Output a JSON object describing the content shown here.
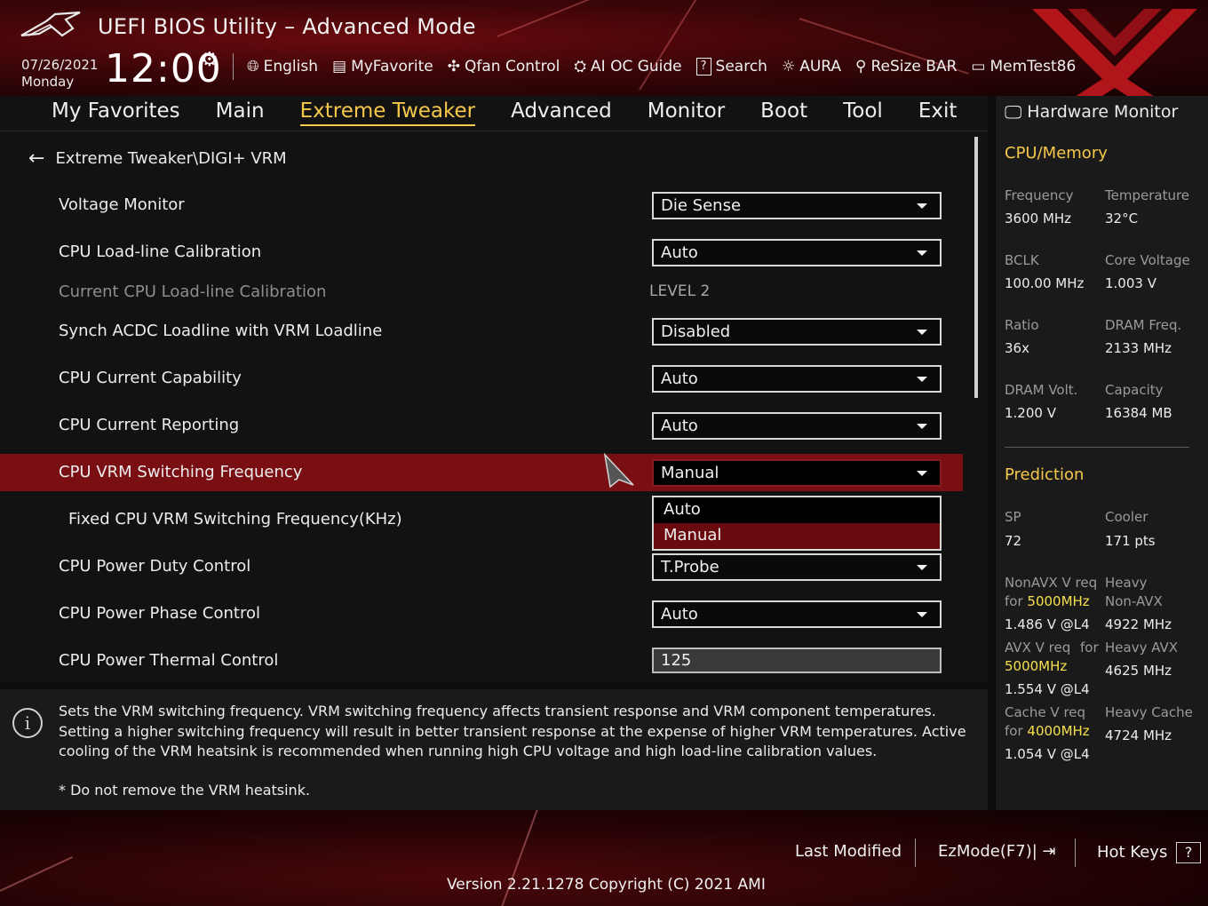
{
  "header": {
    "title": "UEFI BIOS Utility – Advanced Mode",
    "date": "07/26/2021",
    "day": "Monday",
    "time": "12:00",
    "tools": [
      {
        "icon": "globe-icon",
        "label": "English"
      },
      {
        "icon": "favorite-icon",
        "label": "MyFavorite"
      },
      {
        "icon": "fan-icon",
        "label": "Qfan Control"
      },
      {
        "icon": "ai-oc-icon",
        "label": "AI OC Guide"
      },
      {
        "icon": "search-icon",
        "label": "Search"
      },
      {
        "icon": "aura-icon",
        "label": "AURA"
      },
      {
        "icon": "resize-bar-icon",
        "label": "ReSize BAR"
      },
      {
        "icon": "memtest-icon",
        "label": "MemTest86"
      }
    ]
  },
  "nav": {
    "tabs": [
      "My Favorites",
      "Main",
      "Extreme Tweaker",
      "Advanced",
      "Monitor",
      "Boot",
      "Tool",
      "Exit"
    ],
    "active": "Extreme Tweaker"
  },
  "main": {
    "breadcrumb": "Extreme Tweaker\\DIGI+ VRM",
    "rows": [
      {
        "label": "Voltage Monitor",
        "value": "Die Sense"
      },
      {
        "label": "CPU Load-line Calibration",
        "value": "Auto"
      },
      {
        "label": "Current CPU Load-line Calibration",
        "value": "LEVEL 2"
      },
      {
        "label": "Synch ACDC Loadline with VRM Loadline",
        "value": "Disabled"
      },
      {
        "label": "CPU Current Capability",
        "value": "Auto"
      },
      {
        "label": "CPU Current Reporting",
        "value": "Auto"
      },
      {
        "label": "CPU VRM Switching Frequency",
        "value": "Manual"
      },
      {
        "label": "Fixed CPU VRM Switching Frequency(KHz)",
        "value": ""
      },
      {
        "label": "CPU Power Duty Control",
        "value": "T.Probe"
      },
      {
        "label": "CPU Power Phase Control",
        "value": "Auto"
      },
      {
        "label": "CPU Power Thermal Control",
        "value": "125"
      }
    ],
    "dropdown_options": [
      "Auto",
      "Manual"
    ],
    "dropdown_selected": "Manual"
  },
  "help": {
    "text": "Sets the VRM switching frequency.  VRM switching frequency affects transient response and VRM component temperatures. Setting a higher switching frequency will result in better transient response at the expense of higher VRM temperatures. Active cooling of the VRM heatsink is recommended when running high CPU voltage and high load-line calibration values.",
    "note": "* Do not remove the VRM heatsink."
  },
  "hw_monitor": {
    "title": "Hardware Monitor",
    "cpu_section": "CPU/Memory",
    "cpu_items": [
      {
        "label": "Frequency",
        "value": "3600 MHz"
      },
      {
        "label": "Temperature",
        "value": "32°C"
      },
      {
        "label": "BCLK",
        "value": "100.00 MHz"
      },
      {
        "label": "Core Voltage",
        "value": "1.003 V"
      },
      {
        "label": "Ratio",
        "value": "36x"
      },
      {
        "label": "DRAM Freq.",
        "value": "2133 MHz"
      },
      {
        "label": "DRAM Volt.",
        "value": "1.200 V"
      },
      {
        "label": "Capacity",
        "value": "16384 MB"
      }
    ],
    "prediction_section": "Prediction",
    "sp_label": "SP",
    "sp_value": "72",
    "cooler_label": "Cooler",
    "cooler_value": "171 pts",
    "nonavx_label1": "NonAVX V req",
    "nonavx_label2": "for",
    "nonavx_freq": "5000MHz",
    "nonavx_value": "1.486 V @L4",
    "heavy_nonavx_label1": "Heavy",
    "heavy_nonavx_label2": "Non-AVX",
    "heavy_nonavx_value": "4922 MHz",
    "avx_label1": "AVX V req",
    "avx_label2": "for",
    "avx_freq": "5000MHz",
    "avx_value": "1.554 V @L4",
    "heavy_avx_label": "Heavy AVX",
    "heavy_avx_value": "4625 MHz",
    "cache_label1": "Cache V req",
    "cache_label2": "for",
    "cache_freq": "4000MHz",
    "cache_value": "1.054 V @L4",
    "heavy_cache_label": "Heavy Cache",
    "heavy_cache_value": "4724 MHz"
  },
  "footer": {
    "last_modified": "Last Modified",
    "ezmode": "EzMode(F7)|",
    "hot_keys": "Hot Keys",
    "hot_keys_box": "?",
    "version": "Version 2.21.1278 Copyright (C) 2021 AMI"
  },
  "colors": {
    "accent": "#f5c84c",
    "selected_row": "#7a0f13",
    "highlight": "#6a0a0e",
    "prediction_yellow": "#f5e04c"
  }
}
